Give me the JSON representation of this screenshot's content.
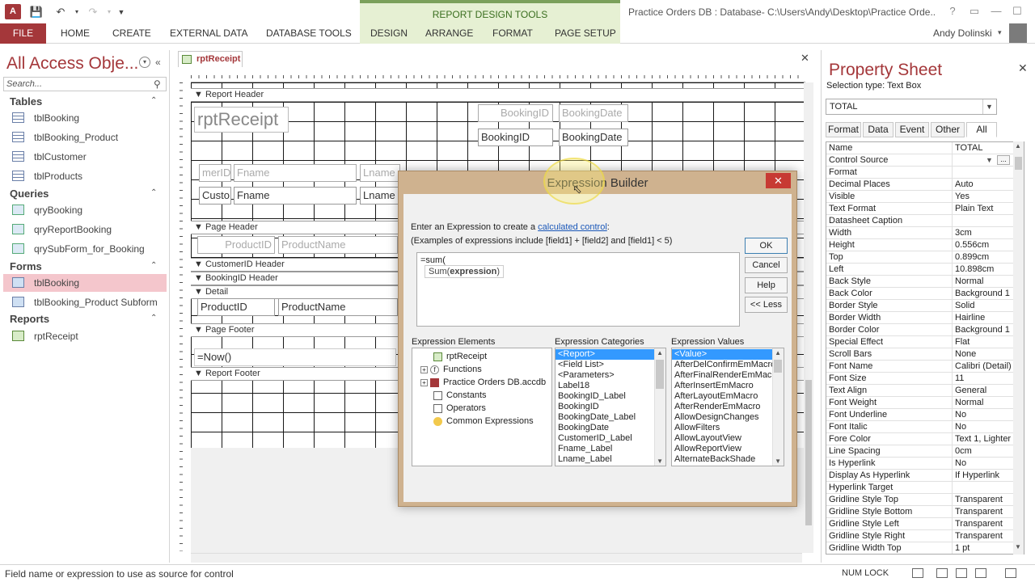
{
  "titlebar": {
    "contextual_group": "REPORT DESIGN TOOLS",
    "window_title": "Practice Orders DB : Database- C:\\Users\\Andy\\Desktop\\Practice Orde...",
    "help": "?",
    "user": "Andy Dolinski"
  },
  "ribbon_tabs": [
    "FILE",
    "HOME",
    "CREATE",
    "EXTERNAL DATA",
    "DATABASE TOOLS",
    "DESIGN",
    "ARRANGE",
    "FORMAT",
    "PAGE SETUP"
  ],
  "nav": {
    "title": "All Access Obje...",
    "search_placeholder": "Search...",
    "groups": {
      "tables": "Tables",
      "queries": "Queries",
      "forms": "Forms",
      "reports": "Reports"
    },
    "tables": [
      "tblBooking",
      "tblBooking_Product",
      "tblCustomer",
      "tblProducts"
    ],
    "queries": [
      "qryBooking",
      "qryReportBooking",
      "qrySubForm_for_Booking"
    ],
    "forms": [
      "tblBooking",
      "tblBooking_Product Subform"
    ],
    "reports": [
      "rptReceipt"
    ]
  },
  "document": {
    "tab_label": "rptReceipt",
    "sections": {
      "report_header": "Report Header",
      "page_header": "Page Header",
      "customer_header": "CustomerID Header",
      "booking_header": "BookingID Header",
      "detail": "Detail",
      "page_footer": "Page Footer",
      "report_footer": "Report Footer"
    },
    "controls": {
      "report_title": "rptReceipt",
      "booking_id_label": "BookingID",
      "booking_date_label": "BookingDate",
      "booking_id_field": "BookingID",
      "booking_date_field": "BookingDate",
      "customer_id_label": "merID",
      "fname_label": "Fname",
      "lname_label": "Lname",
      "customer_id_field": "Custo",
      "fname_field": "Fname",
      "lname_field": "Lname",
      "product_id_label": "ProductID",
      "product_name_label": "ProductName",
      "product_id_field": "ProductID",
      "product_name_field": "ProductName",
      "now_field": "=Now()"
    }
  },
  "dialog": {
    "title": "Expression Builder",
    "hint_prefix": "Enter an Expression to create a ",
    "hint_link": "calculated control",
    "hint_suffix": ":",
    "hint2": "(Examples of expressions include [field1] + [field2] and [field1] < 5)",
    "expression": "=sum(",
    "tooltip_fn": "Sum(",
    "tooltip_arg": "expression",
    "tooltip_close": ")",
    "buttons": {
      "ok": "OK",
      "cancel": "Cancel",
      "help": "Help",
      "less": "<< Less"
    },
    "elements_label": "Expression Elements",
    "categories_label": "Expression Categories",
    "values_label": "Expression Values",
    "elements": [
      "rptReceipt",
      "Functions",
      "Practice Orders DB.accdb",
      "Constants",
      "Operators",
      "Common Expressions"
    ],
    "categories": [
      "<Report>",
      "<Field List>",
      "<Parameters>",
      "Label18",
      "BookingID_Label",
      "BookingID",
      "BookingDate_Label",
      "BookingDate",
      "CustomerID_Label",
      "Fname_Label",
      "Lname_Label"
    ],
    "values": [
      "<Value>",
      "AfterDelConfirmEmMacro",
      "AfterFinalRenderEmMacro",
      "AfterInsertEmMacro",
      "AfterLayoutEmMacro",
      "AfterRenderEmMacro",
      "AllowDesignChanges",
      "AllowFilters",
      "AllowLayoutView",
      "AllowReportView",
      "AlternateBackShade"
    ]
  },
  "property_sheet": {
    "title": "Property Sheet",
    "selection_type": "Selection type:  Text Box",
    "selected_object": "TOTAL",
    "tabs": [
      "Format",
      "Data",
      "Event",
      "Other",
      "All"
    ],
    "rows": [
      [
        "Name",
        "TOTAL"
      ],
      [
        "Control Source",
        ""
      ],
      [
        "Format",
        ""
      ],
      [
        "Decimal Places",
        "Auto"
      ],
      [
        "Visible",
        "Yes"
      ],
      [
        "Text Format",
        "Plain Text"
      ],
      [
        "Datasheet Caption",
        ""
      ],
      [
        "Width",
        "3cm"
      ],
      [
        "Height",
        "0.556cm"
      ],
      [
        "Top",
        "0.899cm"
      ],
      [
        "Left",
        "10.898cm"
      ],
      [
        "Back Style",
        "Normal"
      ],
      [
        "Back Color",
        "Background 1"
      ],
      [
        "Border Style",
        "Solid"
      ],
      [
        "Border Width",
        "Hairline"
      ],
      [
        "Border Color",
        "Background 1"
      ],
      [
        "Special Effect",
        "Flat"
      ],
      [
        "Scroll Bars",
        "None"
      ],
      [
        "Font Name",
        "Calibri (Detail)"
      ],
      [
        "Font Size",
        "11"
      ],
      [
        "Text Align",
        "General"
      ],
      [
        "Font Weight",
        "Normal"
      ],
      [
        "Font Underline",
        "No"
      ],
      [
        "Font Italic",
        "No"
      ],
      [
        "Fore Color",
        "Text 1, Lighter"
      ],
      [
        "Line Spacing",
        "0cm"
      ],
      [
        "Is Hyperlink",
        "No"
      ],
      [
        "Display As Hyperlink",
        "If Hyperlink"
      ],
      [
        "Hyperlink Target",
        ""
      ],
      [
        "Gridline Style Top",
        "Transparent"
      ],
      [
        "Gridline Style Bottom",
        "Transparent"
      ],
      [
        "Gridline Style Left",
        "Transparent"
      ],
      [
        "Gridline Style Right",
        "Transparent"
      ],
      [
        "Gridline Width Top",
        "1 pt"
      ]
    ]
  },
  "status": {
    "text": "Field name or expression to use as source for control",
    "numlock": "NUM LOCK"
  },
  "colors": {
    "accent": "#a4373a",
    "contextual": "#e6f0d3",
    "selection": "#3399ff"
  }
}
